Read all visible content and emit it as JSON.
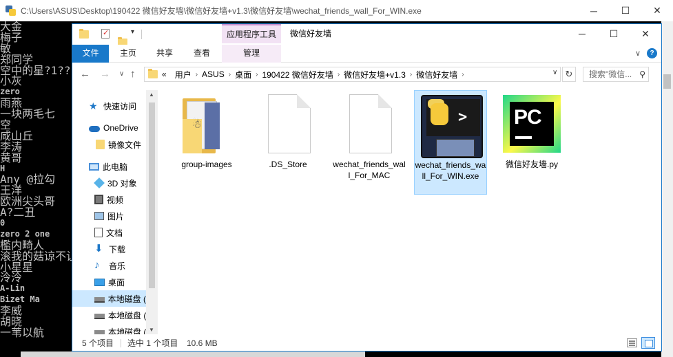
{
  "console": {
    "title": "C:\\Users\\ASUS\\Desktop\\190422 微信好友墙\\微信好友墙+v1.3\\微信好友墙\\wechat_friends_wall_For_WIN.exe",
    "lines": [
      "大金",
      "梅子",
      "敏",
      "郑同学",
      "空中的星?1??",
      "小灰",
      "zero",
      "雨燕",
      "一块两毛七",
      "空",
      "咸山丘",
      "李涛",
      "黄哥",
      "H",
      "Any @拉勾",
      "王洋",
      "欧洲尖头哥",
      "A?二丑",
      "0",
      "zero 2 one",
      "檻内畸人",
      "滚我的菇谅不让",
      "小星星",
      "泠泠",
      "A-Lin",
      "Bizet Ma",
      "李威",
      "胡晓",
      "一苇以航"
    ]
  },
  "window_controls": {
    "minimize": "─",
    "maximize": "☐",
    "close": "✕"
  },
  "explorer": {
    "title": "微信好友墙",
    "context_tab_header": "应用程序工具",
    "tabs": {
      "file": "文件",
      "home": "主页",
      "share": "共享",
      "view": "查看",
      "manage": "管理"
    },
    "help": "?",
    "nav_buttons": {
      "back": "←",
      "forward": "→",
      "recent": "∨",
      "up": "↑",
      "refresh": "↻"
    },
    "address": {
      "prefix": "«",
      "crumbs": [
        "用户",
        "ASUS",
        "桌面",
        "190422 微信好友墙",
        "微信好友墙+v1.3",
        "微信好友墙"
      ],
      "separator": "›"
    },
    "search": {
      "placeholder": "搜索\"微信...",
      "icon": "search-icon"
    },
    "nav_pane": {
      "quick_access": "快速访问",
      "onedrive": "OneDrive",
      "mirror_files": "镜像文件",
      "this_pc": "此电脑",
      "objects_3d": "3D 对象",
      "videos": "视频",
      "pictures": "图片",
      "documents": "文档",
      "downloads": "下载",
      "music": "音乐",
      "desktop": "桌面",
      "local_disk_1": "本地磁盘 (",
      "local_disk_2": "本地磁盘 (",
      "local_disk_3": "本地磁盘 ("
    },
    "files": [
      {
        "name": "group-images",
        "type": "folder"
      },
      {
        "name": ".DS_Store",
        "type": "file"
      },
      {
        "name": "wechat_friends_wall_For_MAC",
        "type": "file"
      },
      {
        "name": "wechat_friends_wall_For_WIN.exe",
        "type": "python-exe",
        "selected": true
      },
      {
        "name": "微信好友墙.py",
        "type": "pycharm"
      }
    ],
    "status": {
      "count": "5 个项目",
      "selected": "选中 1 个项目",
      "size": "10.6 MB"
    }
  },
  "colors": {
    "accent": "#1979ca",
    "selection": "#cce8ff",
    "context_tab": "#f2e2f4"
  }
}
